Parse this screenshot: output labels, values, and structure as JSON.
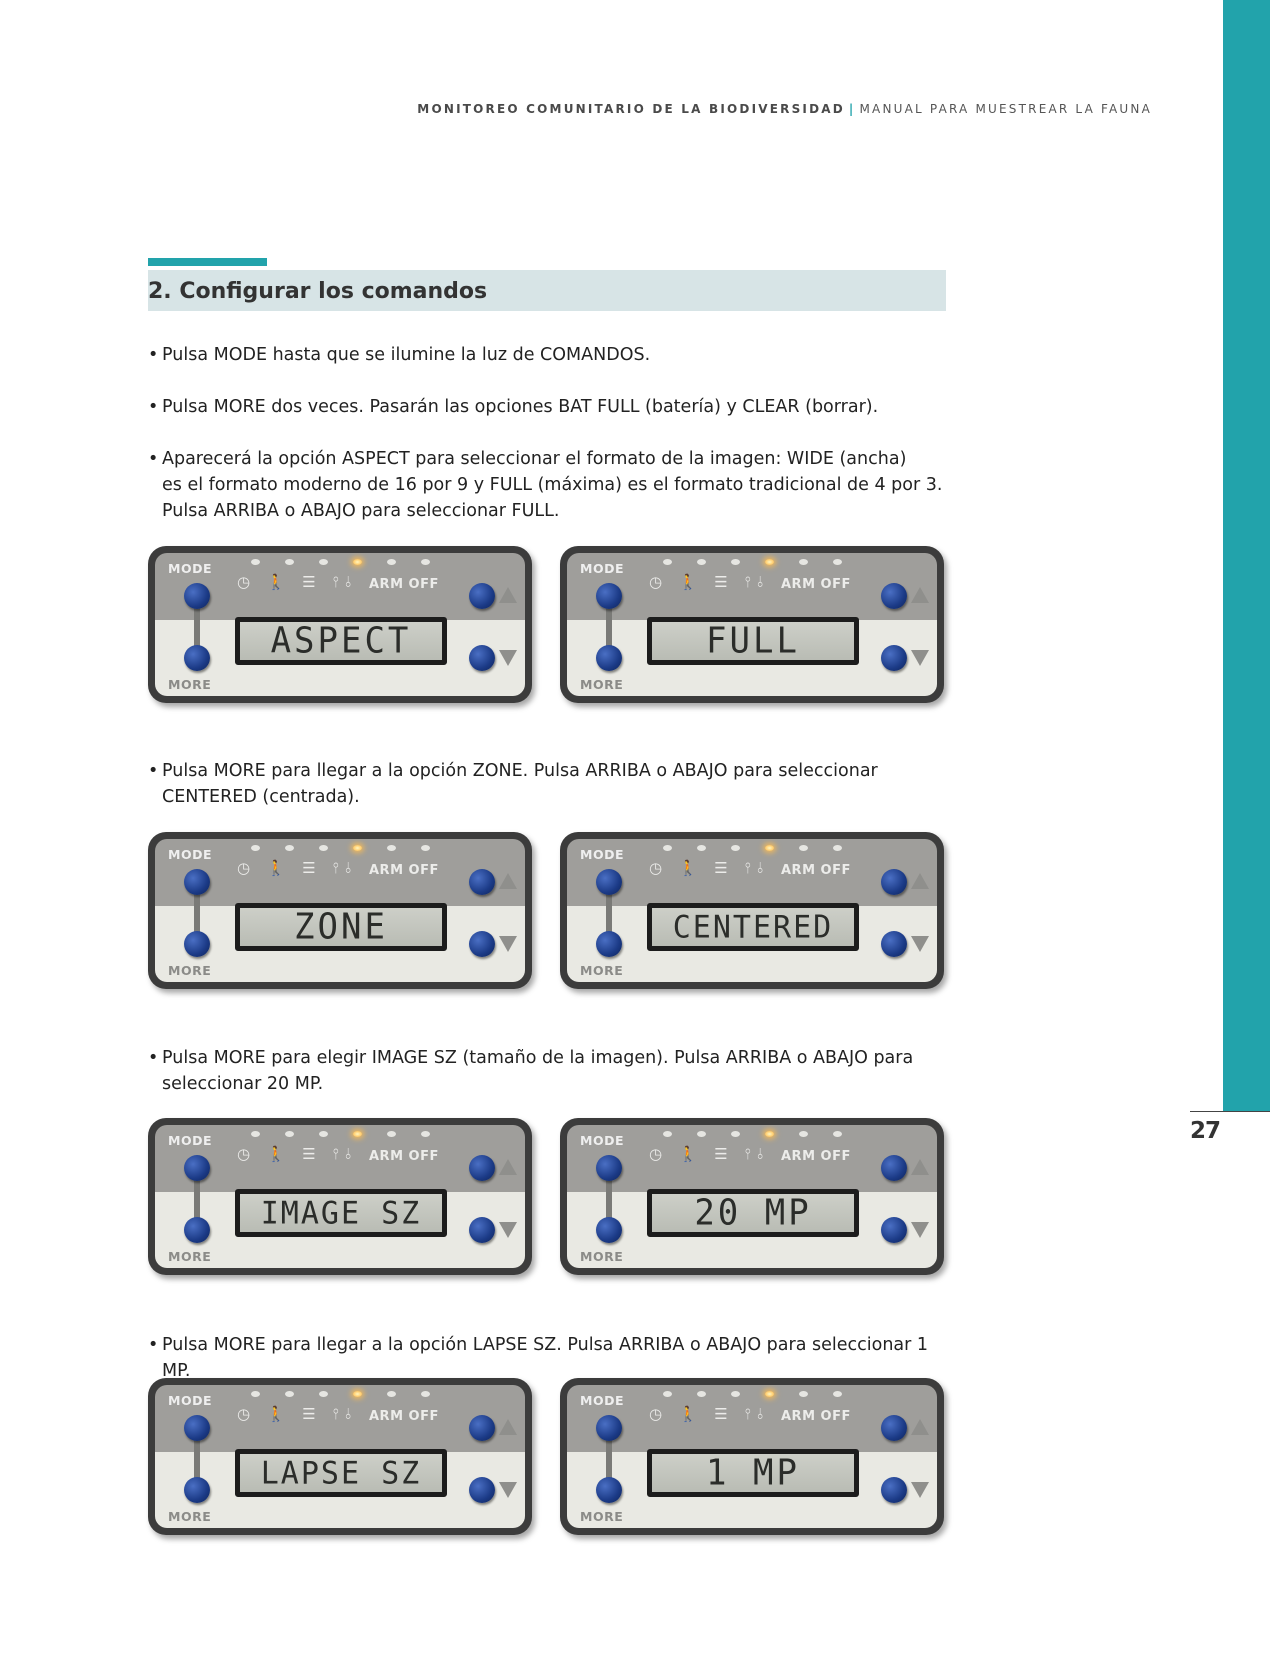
{
  "header": {
    "left": "MONITOREO COMUNITARIO DE LA BIODIVERSIDAD",
    "separator": "|",
    "right": "MANUAL PARA MUESTREAR LA FAUNA"
  },
  "page_number": "27",
  "section": {
    "title": "2. Configurar los comandos"
  },
  "bullets": [
    {
      "dot": "•",
      "lines": [
        "Pulsa MODE hasta que se ilumine la luz de COMANDOS."
      ]
    },
    {
      "dot": "•",
      "lines": [
        "Pulsa MORE dos veces. Pasarán las opciones BAT FULL (batería) y CLEAR (borrar)."
      ]
    },
    {
      "dot": "•",
      "lines": [
        "Aparecerá la opción ASPECT para seleccionar el formato de la imagen: WIDE (ancha)",
        "es el formato moderno de 16 por 9 y FULL (máxima) es el formato tradicional de 4 por 3.",
        "Pulsa ARRIBA o ABAJO para seleccionar FULL."
      ]
    },
    {
      "dot": "•",
      "lines": [
        "Pulsa MORE para llegar a la opción ZONE. Pulsa ARRIBA o ABAJO para seleccionar",
        "CENTERED (centrada)."
      ]
    },
    {
      "dot": "•",
      "lines": [
        "Pulsa MORE para elegir IMAGE SZ (tamaño de la imagen). Pulsa ARRIBA o ABAJO para",
        "seleccionar 20 MP."
      ]
    },
    {
      "dot": "•",
      "lines": [
        "Pulsa MORE para llegar a la opción LAPSE SZ. Pulsa ARRIBA o ABAJO para seleccionar 1 MP."
      ]
    }
  ],
  "panel_labels": {
    "mode": "MODE",
    "more": "MORE",
    "arm_off": "ARM OFF",
    "icons": "◷ 🚶 ☰ ⫯⫰"
  },
  "panels": [
    {
      "display": "ASPECT"
    },
    {
      "display": "FULL"
    },
    {
      "display": "ZONE"
    },
    {
      "display": "CENTERED"
    },
    {
      "display": "IMAGE SZ"
    },
    {
      "display": "20 MP"
    },
    {
      "display": "LAPSE SZ"
    },
    {
      "display": "1 MP"
    }
  ],
  "colors": {
    "accent": "#22a3ab",
    "section_bar": "#d7e4e6",
    "button_blue": "#1b3a86"
  }
}
